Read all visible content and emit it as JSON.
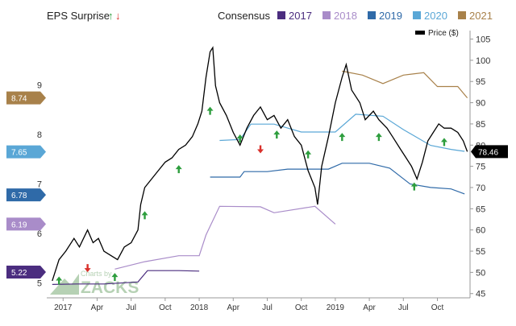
{
  "header": {
    "title": "EPS Surprise",
    "up_arrow": "↑",
    "down_arrow": "↓",
    "consensus_label": "Consensus",
    "price_legend": "Price ($)"
  },
  "watermark": {
    "small": "Charts by",
    "big": "ZACKS"
  },
  "colors": {
    "2017": "#4b2d7f",
    "2018": "#a98cc9",
    "2019": "#2f6aa8",
    "2020": "#5aa7d6",
    "2021": "#a8814a",
    "price": "#000000",
    "beat": "#2e9e3e",
    "miss": "#d9302b"
  },
  "chart_data": {
    "type": "line",
    "title": "EPS Surprise",
    "x_ticks": [
      "2017",
      "Apr",
      "Jul",
      "Oct",
      "2018",
      "Apr",
      "Jul",
      "Oct",
      "2019",
      "Apr",
      "Jul",
      "Oct"
    ],
    "left_axis": {
      "ticks": [
        5,
        6,
        7,
        8,
        9
      ],
      "range": [
        4.7,
        10.1
      ]
    },
    "right_axis": {
      "ticks": [
        45,
        50,
        55,
        60,
        65,
        70,
        75,
        80,
        85,
        90,
        95,
        100,
        105
      ],
      "range": [
        44,
        107
      ]
    },
    "consensus_legend": [
      "2017",
      "2018",
      "2019",
      "2020",
      "2021"
    ],
    "current_values": [
      {
        "label": "8.74",
        "key": "2021",
        "value": 8.74
      },
      {
        "label": "7.65",
        "key": "2020",
        "value": 7.65
      },
      {
        "label": "6.78",
        "key": "2019",
        "value": 6.78
      },
      {
        "label": "6.19",
        "key": "2018",
        "value": 6.19
      },
      {
        "label": "5.22",
        "key": "2017",
        "value": 5.22
      }
    ],
    "price_last": {
      "label": "78.46",
      "value": 78.46
    },
    "consensus_series": [
      {
        "key": "2017",
        "points": [
          [
            2016.92,
            4.97
          ],
          [
            2017.1,
            4.98
          ],
          [
            2017.3,
            4.98
          ],
          [
            2017.55,
            5.02
          ],
          [
            2017.62,
            5.25
          ],
          [
            2017.85,
            5.25
          ],
          [
            2018.0,
            5.24
          ]
        ]
      },
      {
        "key": "2018",
        "points": [
          [
            2017.38,
            5.28
          ],
          [
            2017.6,
            5.43
          ],
          [
            2017.85,
            5.55
          ],
          [
            2018.0,
            5.55
          ],
          [
            2018.05,
            5.97
          ],
          [
            2018.15,
            6.55
          ],
          [
            2018.45,
            6.54
          ],
          [
            2018.55,
            6.42
          ],
          [
            2018.85,
            6.55
          ],
          [
            2019.0,
            6.19
          ]
        ]
      },
      {
        "key": "2019",
        "points": [
          [
            2018.08,
            7.14
          ],
          [
            2018.3,
            7.14
          ],
          [
            2018.33,
            7.25
          ],
          [
            2018.5,
            7.25
          ],
          [
            2018.65,
            7.3
          ],
          [
            2018.8,
            7.3
          ],
          [
            2018.95,
            7.3
          ],
          [
            2019.05,
            7.42
          ],
          [
            2019.25,
            7.42
          ],
          [
            2019.4,
            7.32
          ],
          [
            2019.55,
            7.0
          ],
          [
            2019.7,
            6.93
          ],
          [
            2019.85,
            6.9
          ],
          [
            2019.95,
            6.8
          ]
        ]
      },
      {
        "key": "2020",
        "points": [
          [
            2018.15,
            7.88
          ],
          [
            2018.3,
            7.9
          ],
          [
            2018.38,
            8.21
          ],
          [
            2018.55,
            8.21
          ],
          [
            2018.75,
            8.05
          ],
          [
            2019.0,
            8.05
          ],
          [
            2019.15,
            8.41
          ],
          [
            2019.35,
            8.37
          ],
          [
            2019.5,
            8.1
          ],
          [
            2019.7,
            7.78
          ],
          [
            2019.85,
            7.7
          ],
          [
            2019.95,
            7.66
          ]
        ]
      },
      {
        "key": "2021",
        "points": [
          [
            2019.05,
            9.28
          ],
          [
            2019.2,
            9.2
          ],
          [
            2019.35,
            9.03
          ],
          [
            2019.5,
            9.2
          ],
          [
            2019.65,
            9.25
          ],
          [
            2019.75,
            8.97
          ],
          [
            2019.9,
            8.97
          ],
          [
            2019.97,
            8.74
          ]
        ]
      }
    ],
    "price": [
      [
        2016.92,
        48
      ],
      [
        2016.97,
        53
      ],
      [
        2017.02,
        55
      ],
      [
        2017.08,
        58
      ],
      [
        2017.12,
        56
      ],
      [
        2017.18,
        60
      ],
      [
        2017.22,
        57
      ],
      [
        2017.26,
        58
      ],
      [
        2017.3,
        55
      ],
      [
        2017.35,
        54
      ],
      [
        2017.4,
        53
      ],
      [
        2017.45,
        56
      ],
      [
        2017.5,
        57
      ],
      [
        2017.55,
        60
      ],
      [
        2017.57,
        66
      ],
      [
        2017.6,
        70
      ],
      [
        2017.65,
        72
      ],
      [
        2017.7,
        74
      ],
      [
        2017.75,
        76
      ],
      [
        2017.8,
        77
      ],
      [
        2017.85,
        79
      ],
      [
        2017.9,
        80
      ],
      [
        2017.95,
        82
      ],
      [
        2017.99,
        85
      ],
      [
        2018.02,
        88
      ],
      [
        2018.05,
        96
      ],
      [
        2018.08,
        102
      ],
      [
        2018.1,
        103
      ],
      [
        2018.12,
        94
      ],
      [
        2018.15,
        90
      ],
      [
        2018.2,
        87
      ],
      [
        2018.25,
        83
      ],
      [
        2018.3,
        80
      ],
      [
        2018.35,
        84
      ],
      [
        2018.4,
        87
      ],
      [
        2018.45,
        89
      ],
      [
        2018.5,
        86
      ],
      [
        2018.55,
        87
      ],
      [
        2018.6,
        84
      ],
      [
        2018.65,
        86
      ],
      [
        2018.7,
        82
      ],
      [
        2018.75,
        80
      ],
      [
        2018.8,
        74
      ],
      [
        2018.85,
        70
      ],
      [
        2018.87,
        66
      ],
      [
        2018.9,
        75
      ],
      [
        2018.95,
        82
      ],
      [
        2019.0,
        90
      ],
      [
        2019.05,
        96
      ],
      [
        2019.08,
        99
      ],
      [
        2019.12,
        93
      ],
      [
        2019.18,
        90
      ],
      [
        2019.22,
        86
      ],
      [
        2019.28,
        88
      ],
      [
        2019.32,
        86
      ],
      [
        2019.38,
        84
      ],
      [
        2019.42,
        82
      ],
      [
        2019.48,
        79
      ],
      [
        2019.52,
        77
      ],
      [
        2019.56,
        75
      ],
      [
        2019.6,
        72
      ],
      [
        2019.64,
        76
      ],
      [
        2019.68,
        81
      ],
      [
        2019.72,
        83
      ],
      [
        2019.76,
        85
      ],
      [
        2019.8,
        84
      ],
      [
        2019.85,
        84
      ],
      [
        2019.9,
        83
      ],
      [
        2019.94,
        81
      ],
      [
        2019.97,
        78.46
      ]
    ],
    "surprises": [
      {
        "x": 2016.97,
        "value": 5.05,
        "type": "beat"
      },
      {
        "x": 2017.18,
        "value": 5.3,
        "type": "miss"
      },
      {
        "x": 2017.38,
        "value": 5.12,
        "type": "beat"
      },
      {
        "x": 2017.6,
        "value": 6.37,
        "type": "beat"
      },
      {
        "x": 2017.85,
        "value": 7.3,
        "type": "beat"
      },
      {
        "x": 2018.08,
        "value": 8.48,
        "type": "beat"
      },
      {
        "x": 2018.3,
        "value": 7.92,
        "type": "beat"
      },
      {
        "x": 2018.45,
        "value": 7.7,
        "type": "miss"
      },
      {
        "x": 2018.57,
        "value": 8.0,
        "type": "beat"
      },
      {
        "x": 2018.8,
        "value": 7.6,
        "type": "beat"
      },
      {
        "x": 2019.05,
        "value": 7.95,
        "type": "beat"
      },
      {
        "x": 2019.32,
        "value": 7.95,
        "type": "beat"
      },
      {
        "x": 2019.58,
        "value": 6.95,
        "type": "beat"
      },
      {
        "x": 2019.8,
        "value": 7.85,
        "type": "beat"
      }
    ]
  }
}
